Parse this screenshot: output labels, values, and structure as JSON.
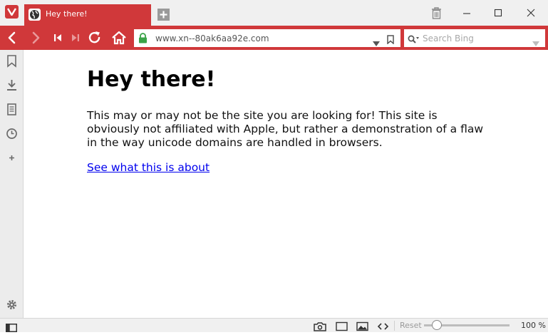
{
  "tab": {
    "title": "Hey there!"
  },
  "address_bar": {
    "url": "www.xn--80ak6aa92e.com"
  },
  "search": {
    "placeholder": "Search Bing"
  },
  "page": {
    "heading": "Hey there!",
    "paragraph": "This may or may not be the site you are looking for! This site is obviously not affiliated with Apple, but rather a demonstration of a flaw in the way unicode domains are handled in browsers.",
    "link_text": "See what this is about"
  },
  "statusbar": {
    "reset_label": "Reset",
    "zoom_level": "100 %",
    "zoom_fraction": 0.15
  },
  "colors": {
    "accent": "#d0383a",
    "link": "#0000ee",
    "secure_lock": "#3aa348"
  },
  "icons": {
    "app": "vivaldi-logo-icon",
    "tab_favicon": "globe-icon",
    "new_tab": "plus-icon",
    "trash": "trash-icon",
    "nav": [
      "back-icon",
      "forward-icon",
      "rewind-icon",
      "fast-forward-icon",
      "reload-icon",
      "home-icon"
    ],
    "side": [
      "bookmark-icon",
      "download-icon",
      "notes-icon",
      "history-icon",
      "add-panel-icon",
      "settings-icon"
    ],
    "status": [
      "panel-toggle-icon",
      "capture-icon",
      "tiling-icon",
      "image-icon",
      "code-icon"
    ]
  }
}
